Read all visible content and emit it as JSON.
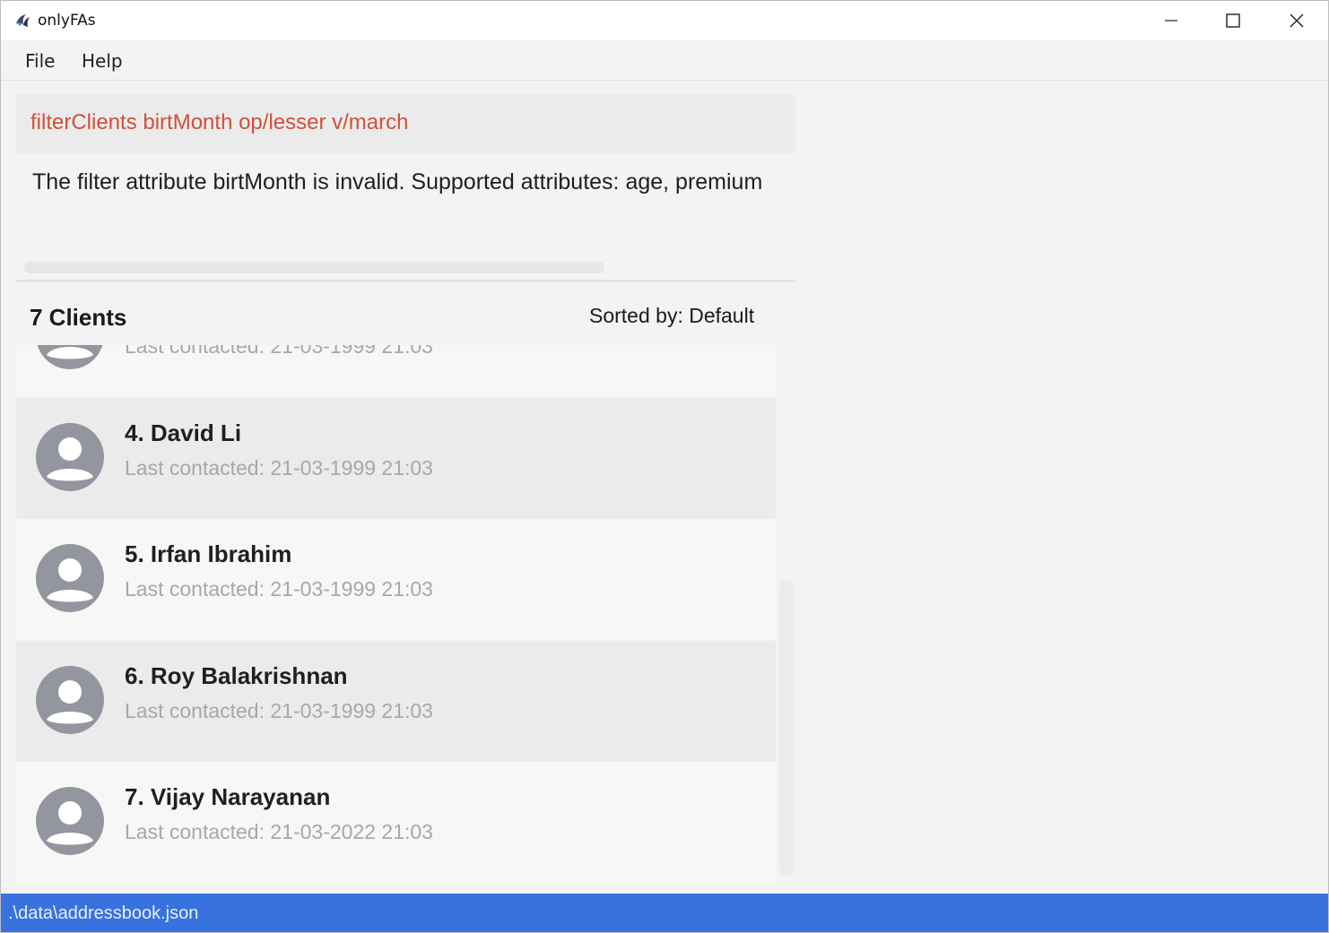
{
  "window": {
    "title": "onlyFAs",
    "controls": [
      "minimize-icon",
      "maximize-icon",
      "close-icon"
    ]
  },
  "menu": {
    "file": "File",
    "help": "Help"
  },
  "command": {
    "text": "filterClients birtMonth op/lesser v/march"
  },
  "result": {
    "text": "The filter attribute birtMonth is invalid. Supported attributes: age, premium"
  },
  "list": {
    "count_label": "7 Clients",
    "sort_label": "Sorted by: Default",
    "partial_item": {
      "contact": "Last contacted: 21-03-1999 21:03"
    },
    "items": [
      {
        "name": "4.  David Li",
        "contact": "Last contacted: 21-03-1999 21:03"
      },
      {
        "name": "5.  Irfan Ibrahim",
        "contact": "Last contacted: 21-03-1999 21:03"
      },
      {
        "name": "6.  Roy Balakrishnan",
        "contact": "Last contacted: 21-03-1999 21:03"
      },
      {
        "name": "7.  Vijay Narayanan",
        "contact": "Last contacted: 21-03-2022 21:03"
      }
    ]
  },
  "status": {
    "path": ".\\data\\addressbook.json"
  },
  "colors": {
    "accent": "#3872df",
    "command_text": "#d24f3b",
    "contact_text": "#a7a7ad"
  }
}
